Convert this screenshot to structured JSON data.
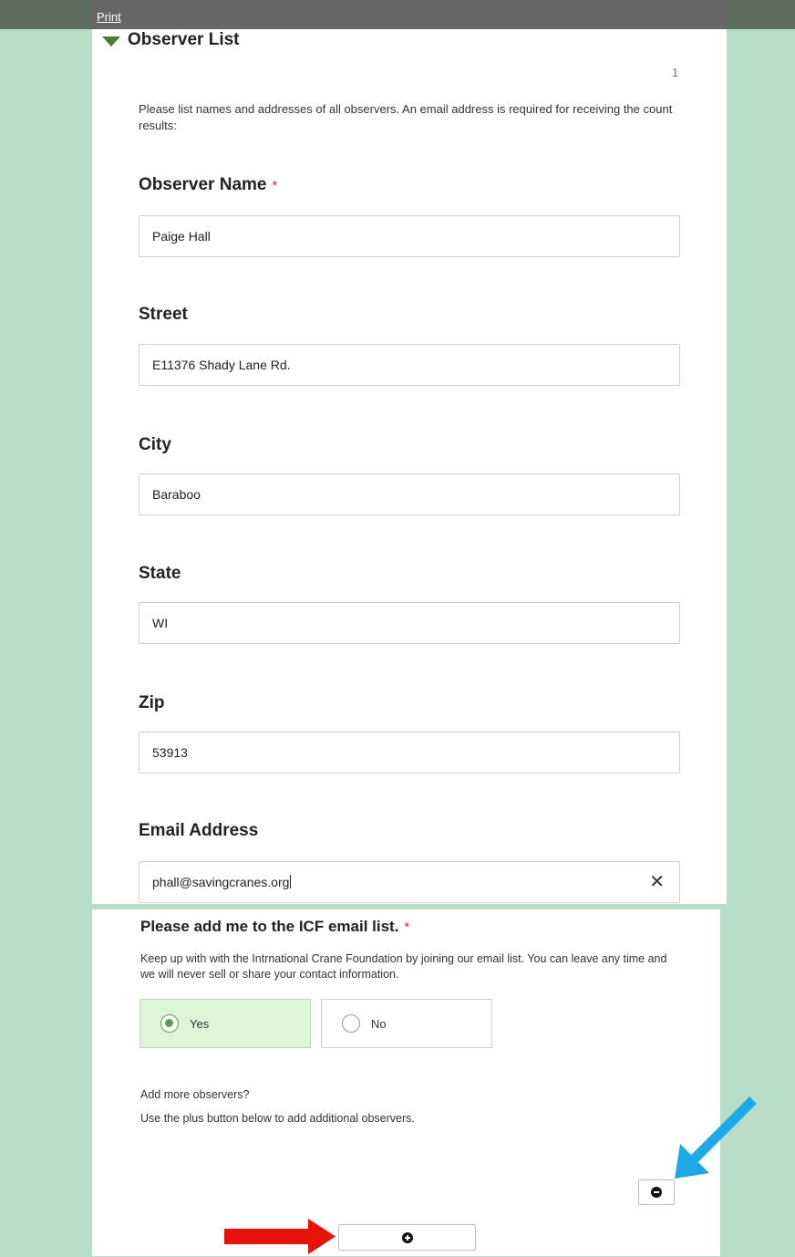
{
  "toolbar": {
    "print_label": "Print"
  },
  "group": {
    "title": "Observer List",
    "page_number": "1"
  },
  "intro_text": "Please list names and addresses of all observers. An email address is required for receiving the count results:",
  "fields": {
    "observer_name": {
      "label": "Observer Name",
      "required_mark": "*",
      "value": "Paige Hall"
    },
    "street": {
      "label": "Street",
      "value": "E11376 Shady Lane Rd."
    },
    "city": {
      "label": "City",
      "value": "Baraboo"
    },
    "state": {
      "label": "State",
      "value": "WI"
    },
    "zip": {
      "label": "Zip",
      "value": "53913"
    },
    "email": {
      "label": "Email Address",
      "value": "phall@savingcranes.org",
      "clear_icon": "close-icon"
    }
  },
  "email_list_question": {
    "label": "Please add me to the ICF email list.",
    "required_mark": "*",
    "description": "Keep up with with the Intrnational Crane Foundation by joining our email list. You can leave any time and we will never sell or share your contact information.",
    "options": [
      {
        "label": "Yes",
        "selected": true
      },
      {
        "label": "No",
        "selected": false
      }
    ]
  },
  "notes": {
    "line1": "Add more observers?",
    "line2": "Use the plus button below to add additional observers."
  },
  "buttons": {
    "remove_icon": "minus-circle-icon",
    "add_icon": "plus-circle-icon"
  },
  "colors": {
    "background": "#b7dcc8",
    "topbar": "#666666",
    "selected_option": "#dff5d8",
    "radio_accent": "#5c9e4c",
    "required": "#c0392b",
    "callout_red": "#e8120c",
    "callout_blue": "#1ea8e6"
  }
}
